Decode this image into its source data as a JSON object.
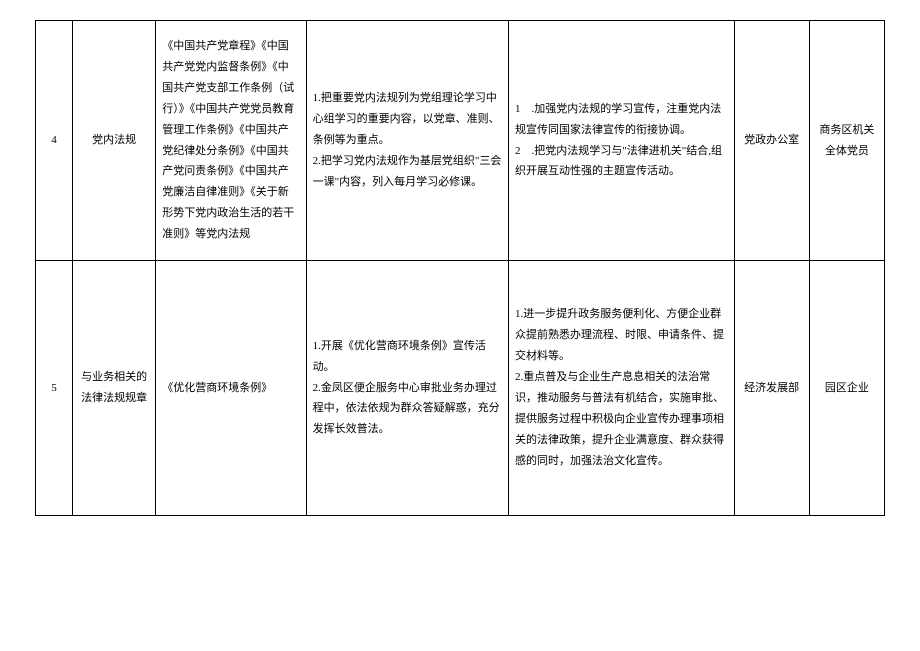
{
  "rows": [
    {
      "num": "4",
      "category": "党内法规",
      "reference": "《中国共产党章程》《中国共产党党内监督条例》《中国共产党支部工作条例（试行）》《中国共产党党员教育管理工作条例》《中国共产党纪律处分条例》《中国共产党问责条例》《中国共产党廉洁自律准则》《关于新形势下党内政治生活的若干准则》等党内法规",
      "task1": "1.把重要党内法规列为党组理论学习中心组学习的重要内容，以党章、准则、条例等为重点。\n2.把学习党内法规作为基层党组织\"三会一课\"内容，列入每月学习必修课。",
      "task2": "1　.加强党内法规的学习宣传，注重党内法规宣传同国家法律宣传的衔接协调。\n2　.把党内法规学习与\"法律进机关\"结合,组织开展互动性强的主题宣传活动。",
      "dept": "党政办公室",
      "target": "商务区机关全体党员"
    },
    {
      "num": "5",
      "category": "与业务相关的法律法规规章",
      "reference": "《优化营商环境条例》",
      "task1": "1.开展《优化营商环境条例》宣传活动。\n2.金凤区便企服务中心审批业务办理过程中，依法依规为群众答疑解惑，充分发挥长效普法。",
      "task2": "1.进一步提升政务服务便利化、方便企业群众提前熟悉办理流程、时限、申请条件、提交材料等。\n2.重点普及与企业生产息息相关的法治常识，推动服务与普法有机结合，实施审批、提供服务过程中积极向企业宣传办理事项相关的法律政策，提升企业满意度、群众获得感的同时，加强法治文化宣传。",
      "dept": "经济发展部",
      "target": "园区企业"
    }
  ]
}
